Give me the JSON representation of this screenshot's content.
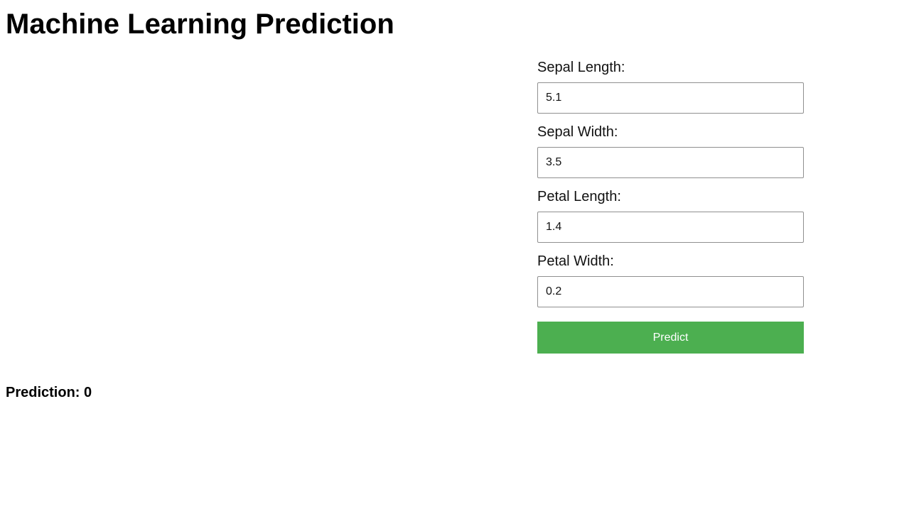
{
  "page": {
    "title": "Machine Learning Prediction"
  },
  "form": {
    "fields": [
      {
        "label": "Sepal Length:",
        "value": "5.1"
      },
      {
        "label": "Sepal Width:",
        "value": "3.5"
      },
      {
        "label": "Petal Length:",
        "value": "1.4"
      },
      {
        "label": "Petal Width:",
        "value": "0.2"
      }
    ],
    "submit_label": "Predict"
  },
  "result": {
    "prefix": "Prediction:",
    "value": "0"
  },
  "colors": {
    "accent": "#4caf50",
    "text": "#000000",
    "background": "#ffffff"
  }
}
